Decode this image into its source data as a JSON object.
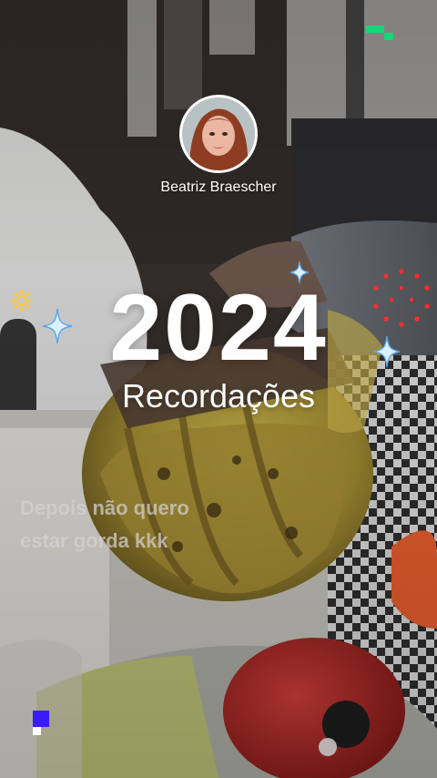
{
  "story": {
    "username": "Beatriz Braescher",
    "year": "2024",
    "subtitle": "Recordações",
    "caption_line1": "Depois não quero",
    "caption_line2": "estar gorda kkk"
  },
  "icons": {
    "avatar": "profile-photo",
    "sparkle": "sparkle-icon",
    "sun": "sun-icon",
    "dots": "dotted-circle-icon"
  },
  "colors": {
    "text": "#ffffff",
    "sparkle_fill": "#d9f1ff",
    "sparkle_outline": "#5aa6e6",
    "sun": "#ffc83a",
    "dots": "#ff2d2d",
    "pixel_green": "#14d777",
    "pixel_blue": "#3b1bff"
  }
}
